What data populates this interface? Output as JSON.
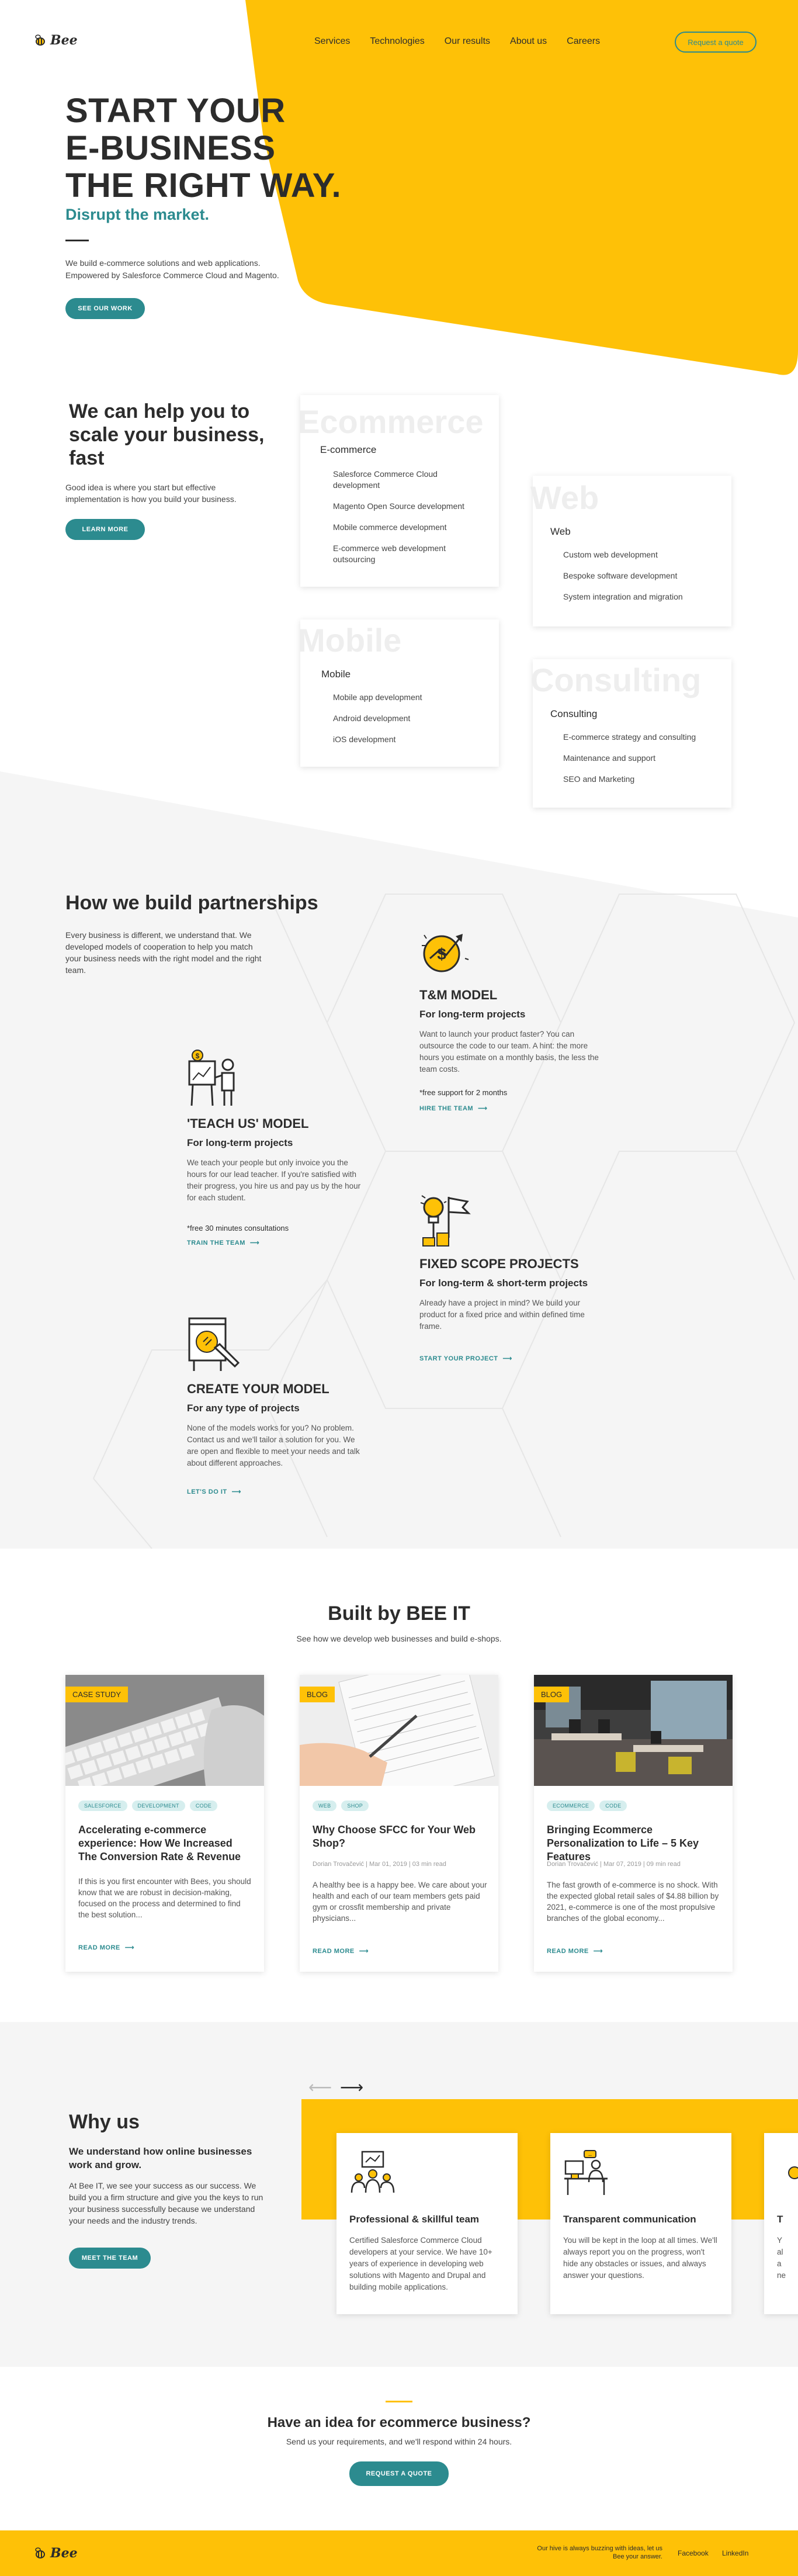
{
  "colors": {
    "accent_yellow": "#fec107",
    "accent_teal": "#2c8b8f",
    "text_dark": "#2c2c2c",
    "grey_bg": "#f5f5f5"
  },
  "header": {
    "logo_text": "Bee",
    "nav": [
      "Services",
      "Technologies",
      "Our results",
      "About us",
      "Careers"
    ],
    "quote_button": "Request a quote"
  },
  "hero": {
    "title_lines": [
      "START YOUR",
      "E-BUSINESS",
      "THE RIGHT WAY."
    ],
    "subtitle": "Disrupt the market.",
    "description": "We build e-commerce solutions and web applications. Empowered by Salesforce Commerce Cloud and Magento.",
    "button": "SEE OUR WORK"
  },
  "services": {
    "title": "We can help you to scale your business, fast",
    "description": "Good idea is where you start but effective implementation is how you build your business.",
    "button": "LEARN MORE",
    "cards": [
      {
        "ghost": "Ecommerce",
        "title": "E-commerce",
        "items": [
          "Salesforce Commerce Cloud development",
          "Magento Open Source development",
          "Mobile commerce development",
          "E-commerce web development outsourcing"
        ]
      },
      {
        "ghost": "Web",
        "title": "Web",
        "items": [
          "Custom web development",
          "Bespoke software development",
          "System integration and migration"
        ]
      },
      {
        "ghost": "Mobile",
        "title": "Mobile",
        "items": [
          "Mobile app development",
          "Android development",
          "iOS development"
        ]
      },
      {
        "ghost": "Consulting",
        "title": "Consulting",
        "items": [
          "E-commerce strategy and consulting",
          "Maintenance and support",
          "SEO and Marketing"
        ]
      }
    ]
  },
  "partnerships": {
    "title": "How we build partnerships",
    "description": "Every business is different, we understand that. We developed models of cooperation to help you match your business needs with the right model and the right team.",
    "models": [
      {
        "icon": "money-growth-icon",
        "title": "T&M MODEL",
        "subtitle": "For long-term projects",
        "desc": "Want to launch your product faster? You can outsource the code to our team. A hint: the more hours you estimate on a monthly basis, the less the team costs.",
        "note": "*free support for 2 months",
        "link": "HIRE THE TEAM"
      },
      {
        "icon": "teacher-board-icon",
        "title": "'TEACH US' MODEL",
        "subtitle": "For long-term projects",
        "desc": "We teach your people but only invoice you the hours for our lead teacher. If you're satisfied with their progress, you hire us and pay us by the hour for each student.",
        "note": "*free 30 minutes consultations",
        "link": "TRAIN THE TEAM"
      },
      {
        "icon": "lightbulb-flag-icon",
        "title": "FIXED SCOPE PROJECTS",
        "subtitle": "For long-term & short-term projects",
        "desc": "Already have a project in mind? We build your product for a fixed price and within defined time frame.",
        "note": "",
        "link": "START YOUR PROJECT"
      },
      {
        "icon": "drawing-board-icon",
        "title": "CREATE YOUR MODEL",
        "subtitle": "For any type of projects",
        "desc": "None of the models works for you? No problem. Contact us and we'll tailor a solution for you. We are open and flexible to meet your needs and talk about different approaches.",
        "note": "",
        "link": "LET'S DO IT"
      }
    ]
  },
  "built": {
    "title": "Built by BEE IT",
    "subtitle": "See how we develop web businesses and build e-shops.",
    "posts": [
      {
        "badge": "CASE STUDY",
        "tags": [
          "SALESFORCE",
          "DEVELOPMENT",
          "CODE"
        ],
        "title": "Accelerating e-commerce experience: How We Increased The Conversion Rate & Revenue",
        "meta": "",
        "excerpt": "If this is you first encounter with Bees, you should know that we are robust in decision-making, focused on the process and determined to find the best solution...",
        "more": "READ MORE"
      },
      {
        "badge": "BLOG",
        "tags": [
          "WEB",
          "SHOP"
        ],
        "title": "Why Choose SFCC for Your Web Shop?",
        "meta": "Dorian Trovačević | Mar 01, 2019 | 03 min read",
        "excerpt": "A healthy bee is a happy bee. We care about your health and each of our team members gets paid gym or crossfit membership and private physicians...",
        "more": "READ MORE"
      },
      {
        "badge": "BLOG",
        "tags": [
          "ECOMMERCE",
          "CODE"
        ],
        "title": "Bringing Ecommerce Personalization to Life – 5 Key Features",
        "meta": "Dorian Trovačević | Mar 07, 2019 | 09 min read",
        "excerpt": "The fast growth of e-commerce is no shock. With the expected global retail sales of $4.88 billion by 2021, e-commerce is one of the most propulsive branches of the global economy...",
        "more": "READ MORE"
      }
    ]
  },
  "why": {
    "title": "Why us",
    "subtitle": "We understand how online businesses work and grow.",
    "description": "At Bee IT, we see your success as our success. We build you a firm structure and give you the keys to run your business successfully because we understand your needs and the industry trends.",
    "button": "MEET THE TEAM",
    "cards": [
      {
        "icon": "team-presentation-icon",
        "title": "Professional & skillful team",
        "text": "Certified Salesforce Commerce Cloud developers at your service. We have 10+ years of experience in developing web solutions with Magento and Drupal and building mobile applications."
      },
      {
        "icon": "developer-desk-icon",
        "title": "Transparent communication",
        "text": "You will be kept in the loop at all times. We'll always report you on the progress, won't hide any obstacles or issues, and always answer your questions."
      },
      {
        "icon": "partial-card-icon",
        "title": "T",
        "text": "Y al a ne"
      }
    ]
  },
  "cta": {
    "title": "Have an idea for ecommerce business?",
    "subtitle": "Send us your requirements, and we'll respond within 24 hours.",
    "button": "REQUEST A QUOTE"
  },
  "footer": {
    "logo_text": "Bee",
    "message": "Our hive is always buzzing with ideas, let us Bee your answer.",
    "links": [
      "Facebook",
      "LinkedIn"
    ]
  }
}
